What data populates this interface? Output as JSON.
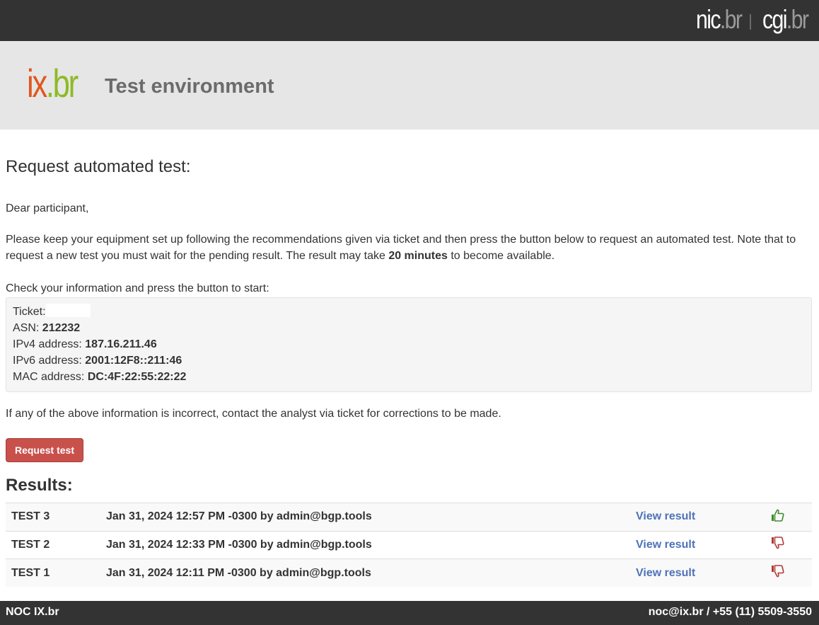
{
  "topbar": {
    "brand_nic": "nic",
    "brand_nic_tld": ".br",
    "brand_cgi": "cgi",
    "brand_cgi_tld": ".br"
  },
  "header": {
    "logo_ix": "ix",
    "logo_dot": ".",
    "logo_br": "br",
    "title": "Test environment"
  },
  "main": {
    "heading": "Request automated test:",
    "greeting": "Dear participant,",
    "intro_before": "Please keep your equipment set up following the recommendations given via ticket and then press the button below to request an automated test. Note that to request a new test you must wait for the pending result. The result may take ",
    "intro_bold": "20 minutes",
    "intro_after": " to become available.",
    "check_text": "Check your information and press the button to start:",
    "info": {
      "ticket_label": "Ticket:",
      "ticket_value": "",
      "asn_label": "ASN: ",
      "asn_value": "212232",
      "ipv4_label": "IPv4 address: ",
      "ipv4_value": "187.16.211.46",
      "ipv6_label": "IPv6 address: ",
      "ipv6_value": "2001:12F8::211:46",
      "mac_label": "MAC address: ",
      "mac_value": "DC:4F:22:55:22:22"
    },
    "incorrect_text": "If any of the above information is incorrect, contact the analyst via ticket for corrections to be made.",
    "request_button": "Request test"
  },
  "results": {
    "heading": "Results:",
    "rows": [
      {
        "name": "TEST 3",
        "date": "Jan 31, 2024 12:57 PM -0300 by admin@bgp.tools",
        "link": "View result",
        "status": "thumbs-up"
      },
      {
        "name": "TEST 2",
        "date": "Jan 31, 2024 12:33 PM -0300 by admin@bgp.tools",
        "link": "View result",
        "status": "thumbs-down"
      },
      {
        "name": "TEST 1",
        "date": "Jan 31, 2024 12:11 PM -0300 by admin@bgp.tools",
        "link": "View result",
        "status": "thumbs-down"
      }
    ]
  },
  "footer": {
    "left": "NOC IX.br",
    "right": "noc@ix.br / +55 (11) 5509-3550"
  },
  "colors": {
    "topbar": "#333333",
    "header_bg": "#e6e6e6",
    "button": "#c9514c",
    "link": "#4f72b8",
    "thumb_up": "#3f8a2e",
    "thumb_down": "#b23a35",
    "logo_orange": "#e0571f",
    "logo_green": "#8dbb25"
  }
}
